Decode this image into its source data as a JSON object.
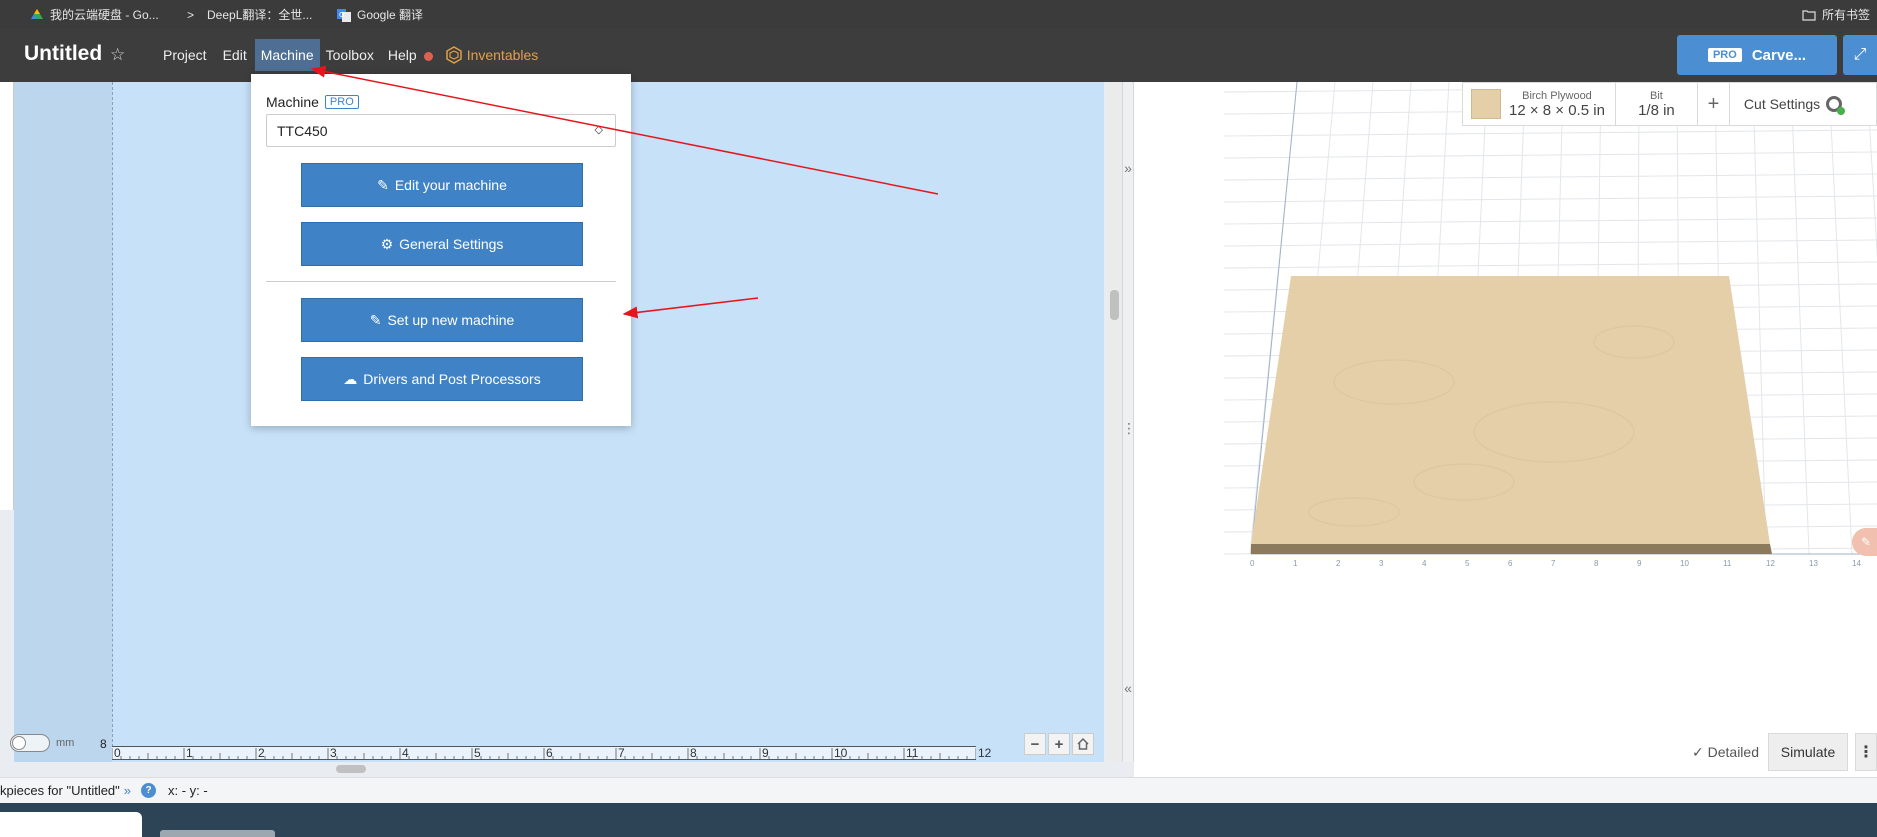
{
  "bookmarks": [
    {
      "label": "我的云端硬盘 - Go...",
      "icon": "google-drive-icon"
    },
    {
      "label": "DeepL翻译：全世...",
      "icon": "deepl-icon"
    },
    {
      "label": "Google 翻译",
      "icon": "google-translate-icon"
    },
    {
      "label": "所有书签",
      "icon": "folder-icon"
    }
  ],
  "app": {
    "title": "Untitled",
    "menu": [
      "Project",
      "Edit",
      "Machine",
      "Toolbox",
      "Help"
    ],
    "inventables_label": "Inventables",
    "pro_badge": "PRO",
    "carve_label": "Carve..."
  },
  "machine_menu": {
    "label": "Machine",
    "pro_badge": "PRO",
    "selected_machine": "TTC450",
    "buttons": [
      "Edit your machine",
      "General Settings",
      "Set up new machine",
      "Drivers and Post Processors"
    ]
  },
  "canvas": {
    "ruler_labels": [
      "0",
      "1",
      "2",
      "3",
      "4",
      "5",
      "6",
      "7",
      "8",
      "9",
      "10",
      "11",
      "12"
    ],
    "left_ruler_label": "8",
    "unit_label": "mm"
  },
  "material": {
    "name": "Birch Plywood",
    "dimensions": "12 × 8 × 0.5 in",
    "bit_label": "Bit",
    "bit_value": "1/8 in",
    "add_label": "+",
    "cut_settings_label": "Cut Settings",
    "color": "#e4cfa9"
  },
  "preview": {
    "detailed_label": "Detailed",
    "simulate_label": "Simulate",
    "more_label": "⋮"
  },
  "status": {
    "workpieces_text": "kpieces for \"Untitled\"",
    "coords_text": "x: - y: -"
  },
  "colors": {
    "accent": "#4b8ed1",
    "canvas": "#c7e1f8",
    "annotation": "#e8141c"
  }
}
